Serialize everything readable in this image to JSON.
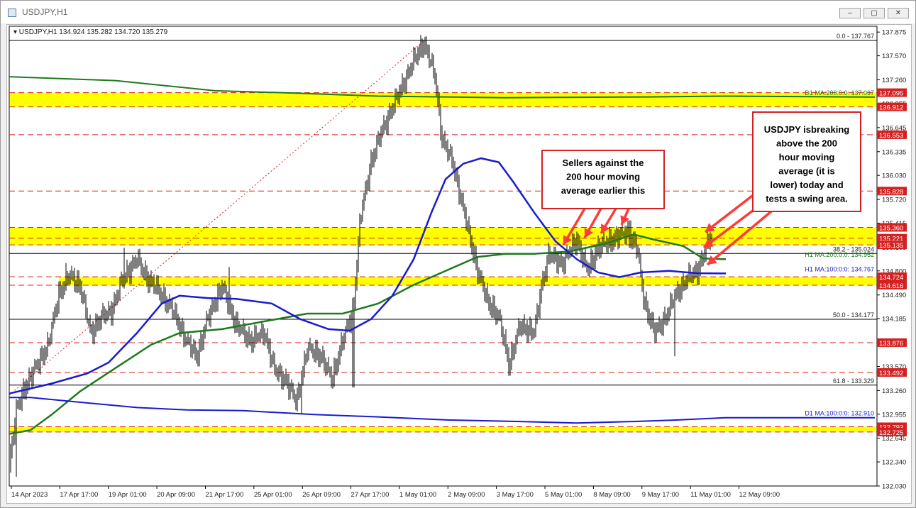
{
  "window": {
    "title": "USDJPY,H1",
    "minimize_glyph": "‒",
    "restore_glyph": "▢",
    "close_glyph": "✕"
  },
  "chart_data": {
    "type": "candlestick",
    "symbol_header": "USDJPY,H1  134.924 135.282 134.720 135.279",
    "ylim": [
      132.03,
      137.95
    ],
    "x_ticks": [
      "14 Apr 2023",
      "17 Apr 17:00",
      "19 Apr 01:00",
      "20 Apr 09:00",
      "21 Apr 17:00",
      "25 Apr 01:00",
      "26 Apr 09:00",
      "27 Apr 17:00",
      "1 May 01:00",
      "2 May 09:00",
      "3 May 17:00",
      "5 May 01:00",
      "8 May 09:00",
      "9 May 17:00",
      "11 May 01:00",
      "12 May 09:00"
    ],
    "y_ticks": [
      "137.875",
      "137.570",
      "137.260",
      "136.955",
      "136.645",
      "136.335",
      "136.030",
      "135.720",
      "135.415",
      "135.105",
      "134.800",
      "134.490",
      "134.185",
      "133.875",
      "133.570",
      "133.260",
      "132.955",
      "132.645",
      "132.340",
      "132.030"
    ],
    "price_tags": [
      {
        "label": "137.095",
        "value": 137.095,
        "color": "#d42020"
      },
      {
        "label": "136.912",
        "value": 136.912,
        "color": "#d42020"
      },
      {
        "label": "136.553",
        "value": 136.553,
        "color": "#d42020"
      },
      {
        "label": "135.828",
        "value": 135.828,
        "color": "#d42020"
      },
      {
        "label": "135.360",
        "value": 135.36,
        "color": "#d42020"
      },
      {
        "label": "135.221",
        "value": 135.221,
        "color": "#d42020"
      },
      {
        "label": "135.135",
        "value": 135.135,
        "color": "#d42020"
      },
      {
        "label": "134.724",
        "value": 134.724,
        "color": "#d42020"
      },
      {
        "label": "134.616",
        "value": 134.616,
        "color": "#d42020"
      },
      {
        "label": "133.876",
        "value": 133.876,
        "color": "#d42020"
      },
      {
        "label": "133.492",
        "value": 133.492,
        "color": "#d42020"
      },
      {
        "label": "132.793",
        "value": 132.793,
        "color": "#d42020"
      },
      {
        "label": "132.725",
        "value": 132.725,
        "color": "#d42020"
      }
    ],
    "zones": [
      {
        "low": 136.912,
        "high": 137.095
      },
      {
        "low": 135.135,
        "high": 135.36
      },
      {
        "low": 134.616,
        "high": 134.724
      },
      {
        "low": 132.725,
        "high": 132.793
      }
    ],
    "red_dashed_levels": [
      137.095,
      136.912,
      136.553,
      135.828,
      135.36,
      135.221,
      135.135,
      134.724,
      134.616,
      133.876,
      133.492,
      132.793,
      132.725
    ],
    "fib_levels": [
      {
        "label": "0.0 - 137.767",
        "value": 137.767
      },
      {
        "label": "38.2 - 135.024",
        "value": 135.024
      },
      {
        "label": "50.0 - 134.177",
        "value": 134.177
      },
      {
        "label": "61.8 - 133.329",
        "value": 133.329
      }
    ],
    "ma_labels": [
      {
        "label": "D1 MA:200:0:0: 137.037",
        "value": 137.037,
        "color": "#1d7a1d"
      },
      {
        "label": "H1 MA:200:0:0: 134.952",
        "value": 134.952,
        "color": "#1d7a1d"
      },
      {
        "label": "H1 MA:100:0:0: 134.767",
        "value": 134.767,
        "color": "#1a1ad0"
      },
      {
        "label": "D1 MA:100:0:0: 132.910",
        "value": 132.91,
        "color": "#1a1ad0"
      }
    ],
    "series": [
      {
        "name": "H1 MA:200",
        "color": "#1d7a1d",
        "points": [
          [
            0,
            132.7
          ],
          [
            30,
            132.75
          ],
          [
            60,
            132.95
          ],
          [
            100,
            133.25
          ],
          [
            150,
            133.55
          ],
          [
            200,
            133.85
          ],
          [
            240,
            134.0
          ],
          [
            300,
            134.05
          ],
          [
            360,
            134.15
          ],
          [
            420,
            134.25
          ],
          [
            470,
            134.25
          ],
          [
            520,
            134.38
          ],
          [
            570,
            134.62
          ],
          [
            620,
            134.82
          ],
          [
            660,
            134.98
          ],
          [
            700,
            135.02
          ],
          [
            740,
            135.02
          ],
          [
            790,
            135.05
          ],
          [
            840,
            135.15
          ],
          [
            880,
            135.27
          ],
          [
            910,
            135.2
          ],
          [
            950,
            135.12
          ],
          [
            978,
            134.96
          ],
          [
            1010,
            134.95
          ]
        ]
      },
      {
        "name": "H1 MA:100",
        "color": "#1a1ad0",
        "points": [
          [
            0,
            133.22
          ],
          [
            60,
            133.35
          ],
          [
            110,
            133.48
          ],
          [
            140,
            133.62
          ],
          [
            180,
            134.0
          ],
          [
            215,
            134.38
          ],
          [
            240,
            134.48
          ],
          [
            280,
            134.45
          ],
          [
            320,
            134.44
          ],
          [
            370,
            134.38
          ],
          [
            410,
            134.18
          ],
          [
            450,
            134.05
          ],
          [
            480,
            134.03
          ],
          [
            510,
            134.18
          ],
          [
            540,
            134.48
          ],
          [
            570,
            134.95
          ],
          [
            595,
            135.55
          ],
          [
            615,
            135.98
          ],
          [
            640,
            136.18
          ],
          [
            665,
            136.25
          ],
          [
            690,
            136.2
          ],
          [
            710,
            135.95
          ],
          [
            740,
            135.55
          ],
          [
            770,
            135.18
          ],
          [
            800,
            134.95
          ],
          [
            830,
            134.78
          ],
          [
            860,
            134.72
          ],
          [
            890,
            134.78
          ],
          [
            930,
            134.8
          ],
          [
            970,
            134.77
          ],
          [
            1010,
            134.767
          ]
        ]
      },
      {
        "name": "D1 MA:200",
        "color": "#1d7a1d",
        "points": [
          [
            0,
            137.3
          ],
          [
            150,
            137.25
          ],
          [
            290,
            137.12
          ],
          [
            400,
            137.09
          ],
          [
            520,
            137.05
          ],
          [
            700,
            137.03
          ],
          [
            900,
            137.04
          ],
          [
            1010,
            137.05
          ],
          [
            1220,
            137.037
          ]
        ]
      },
      {
        "name": "D1 MA:100",
        "color": "#1a1ad0",
        "points": [
          [
            0,
            133.17
          ],
          [
            30,
            133.17
          ],
          [
            110,
            133.1
          ],
          [
            180,
            133.04
          ],
          [
            250,
            133.01
          ],
          [
            330,
            133.0
          ],
          [
            430,
            132.95
          ],
          [
            520,
            132.92
          ],
          [
            620,
            132.88
          ],
          [
            720,
            132.86
          ],
          [
            800,
            132.84
          ],
          [
            880,
            132.86
          ],
          [
            940,
            132.88
          ],
          [
            1010,
            132.91
          ],
          [
            1220,
            132.91
          ]
        ]
      }
    ],
    "price_path": [
      [
        0,
        132.3
      ],
      [
        10,
        133.0
      ],
      [
        22,
        133.3
      ],
      [
        40,
        133.6
      ],
      [
        55,
        133.85
      ],
      [
        70,
        134.5
      ],
      [
        85,
        134.75
      ],
      [
        100,
        134.6
      ],
      [
        115,
        134.0
      ],
      [
        130,
        134.2
      ],
      [
        145,
        134.3
      ],
      [
        160,
        134.7
      ],
      [
        180,
        134.95
      ],
      [
        195,
        134.7
      ],
      [
        210,
        134.55
      ],
      [
        230,
        134.3
      ],
      [
        250,
        133.9
      ],
      [
        265,
        133.7
      ],
      [
        280,
        134.2
      ],
      [
        300,
        134.6
      ],
      [
        320,
        134.1
      ],
      [
        340,
        133.9
      ],
      [
        360,
        134.0
      ],
      [
        375,
        133.5
      ],
      [
        390,
        133.4
      ],
      [
        405,
        133.1
      ],
      [
        420,
        133.8
      ],
      [
        440,
        133.7
      ],
      [
        455,
        133.4
      ],
      [
        470,
        133.9
      ],
      [
        485,
        134.3
      ],
      [
        495,
        135.5
      ],
      [
        510,
        136.2
      ],
      [
        525,
        136.6
      ],
      [
        540,
        136.9
      ],
      [
        555,
        137.2
      ],
      [
        570,
        137.5
      ],
      [
        585,
        137.75
      ],
      [
        600,
        137.3
      ],
      [
        610,
        136.5
      ],
      [
        625,
        136.2
      ],
      [
        640,
        135.6
      ],
      [
        660,
        134.8
      ],
      [
        675,
        134.4
      ],
      [
        690,
        134.2
      ],
      [
        705,
        133.6
      ],
      [
        720,
        134.1
      ],
      [
        740,
        134.0
      ],
      [
        750,
        134.6
      ],
      [
        760,
        135.0
      ],
      [
        780,
        134.9
      ],
      [
        800,
        135.2
      ],
      [
        815,
        134.8
      ],
      [
        830,
        135.1
      ],
      [
        850,
        135.2
      ],
      [
        870,
        135.3
      ],
      [
        885,
        135.1
      ],
      [
        895,
        134.4
      ],
      [
        910,
        134.0
      ],
      [
        925,
        134.2
      ],
      [
        940,
        134.5
      ],
      [
        955,
        134.7
      ],
      [
        970,
        134.8
      ],
      [
        990,
        135.28
      ]
    ],
    "candle_extremes": [
      {
        "at": 10,
        "low": 132.15
      },
      {
        "at": 80,
        "high": 134.9
      },
      {
        "at": 162,
        "high": 135.1
      },
      {
        "at": 310,
        "high": 134.85
      },
      {
        "at": 412,
        "low": 132.95
      },
      {
        "at": 485,
        "low": 133.3
      },
      {
        "at": 588,
        "high": 137.82
      },
      {
        "at": 705,
        "low": 133.45
      },
      {
        "at": 875,
        "high": 135.45
      },
      {
        "at": 938,
        "low": 133.7
      },
      {
        "at": 990,
        "high": 135.28
      }
    ],
    "fib_line": {
      "from": [
        0,
        133.2
      ],
      "to": [
        585,
        137.767
      ]
    },
    "arrows": [
      {
        "from": [
          822,
          289
        ],
        "to": [
          792,
          340
        ]
      },
      {
        "from": [
          845,
          289
        ],
        "to": [
          822,
          330
        ]
      },
      {
        "from": [
          866,
          289
        ],
        "to": [
          845,
          324
        ]
      },
      {
        "from": [
          884,
          289
        ],
        "to": [
          874,
          312
        ]
      },
      {
        "from": [
          1062,
          268
        ],
        "to": [
          992,
          322
        ]
      },
      {
        "from": [
          1072,
          282
        ],
        "to": [
          990,
          344
        ]
      },
      {
        "from": [
          1085,
          293
        ],
        "to": [
          995,
          368
        ]
      }
    ],
    "annotations": [
      {
        "text": [
          "Sellers against the",
          "200 hour moving",
          "average earlier this"
        ]
      },
      {
        "text": [
          "USDJPY isbreaking",
          "above the 200",
          "hour moving",
          "average (it is",
          "lower) today and",
          "tests a swing area."
        ]
      }
    ]
  }
}
